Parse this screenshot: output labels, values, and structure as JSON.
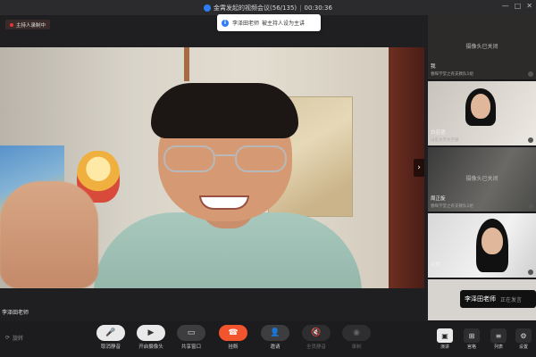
{
  "titlebar": {
    "title": "金霄发起的视频会议(56/135)",
    "separator": "|",
    "timer": "00:30:36",
    "controls": [
      "—",
      "□",
      "✕"
    ]
  },
  "recording": {
    "label": "主持人录制中"
  },
  "toast": {
    "icon": "i",
    "name": "李泽田老师",
    "message": "被主持人设为主讲"
  },
  "main_video": {
    "speaker_name": "李泽田老师"
  },
  "sidebar": {
    "tiles": [
      {
        "camera_off_text": "摄像头已关闭",
        "name": "我",
        "subtitle": "春晖学堂之有支教队1组"
      },
      {
        "name": "白若语",
        "subtitle": "山东大学大学部"
      },
      {
        "camera_off_text": "摄像头已关闭",
        "name": "周正旋",
        "subtitle": "春晖学堂之有支教队1组"
      },
      {
        "name": "余熙",
        "subtitle": ""
      },
      {
        "name": "",
        "subtitle": ""
      }
    ]
  },
  "speaking_popup": {
    "name": "李泽田老师",
    "state": "正在发言"
  },
  "toolbar": {
    "left_label": "旋转",
    "buttons": [
      {
        "icon": "microphone-icon",
        "glyph": "🎤",
        "label": "取消静音"
      },
      {
        "icon": "camera-icon",
        "glyph": "▶",
        "label": "开启摄像头"
      },
      {
        "icon": "share-screen-icon",
        "glyph": "▭",
        "label": "共享窗口"
      },
      {
        "icon": "hangup-icon",
        "glyph": "☎",
        "label": "挂断"
      },
      {
        "icon": "invite-icon",
        "glyph": "👤",
        "label": "邀请"
      },
      {
        "icon": "mute-all-icon",
        "glyph": "🔇",
        "label": "全员静音"
      },
      {
        "icon": "record-icon",
        "glyph": "◉",
        "label": "录制"
      }
    ],
    "views": [
      {
        "icon": "speaker-view-icon",
        "glyph": "▣",
        "label": "演讲"
      },
      {
        "icon": "gallery-view-icon",
        "glyph": "⊞",
        "label": "宫格"
      },
      {
        "icon": "list-view-icon",
        "glyph": "≡",
        "label": "列表"
      },
      {
        "icon": "settings-icon",
        "glyph": "⚙",
        "label": "设置"
      }
    ]
  },
  "colors": {
    "accent": "#2f7df6",
    "hangup": "#f2542d",
    "record_dot": "#ee3333"
  }
}
